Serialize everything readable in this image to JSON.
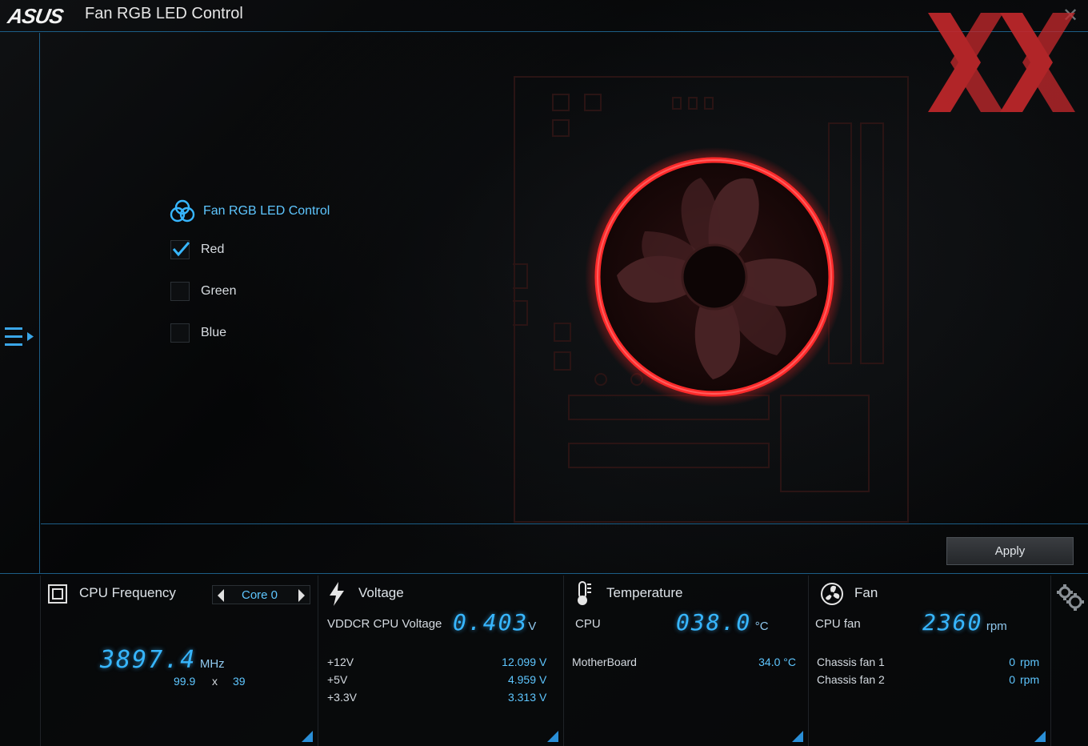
{
  "window": {
    "brand": "ASUS",
    "title": "Fan RGB LED Control",
    "close_glyph": "✕"
  },
  "control": {
    "title": "Fan RGB LED Control",
    "icon": "rgb-circles-icon",
    "options": [
      {
        "label": "Red",
        "checked": true
      },
      {
        "label": "Green",
        "checked": false
      },
      {
        "label": "Blue",
        "checked": false
      }
    ],
    "apply_label": "Apply"
  },
  "cpu_frequency": {
    "title": "CPU Frequency",
    "core_selected": "Core 0",
    "value": "3897.4",
    "unit": "MHz",
    "bclk": "99.9",
    "times": "x",
    "ratio": "39"
  },
  "voltage": {
    "title": "Voltage",
    "main_label": "VDDCR CPU Voltage",
    "main_value": "0.403",
    "main_unit": "V",
    "rows": [
      {
        "label": "+12V",
        "value": "12.099",
        "unit": "V"
      },
      {
        "label": "+5V",
        "value": "4.959",
        "unit": "V"
      },
      {
        "label": "+3.3V",
        "value": "3.313",
        "unit": "V"
      }
    ]
  },
  "temperature": {
    "title": "Temperature",
    "main_label": "CPU",
    "main_value": "038.0",
    "main_unit": "°C",
    "rows": [
      {
        "label": "MotherBoard",
        "value": "34.0 °C"
      }
    ]
  },
  "fan": {
    "title": "Fan",
    "main_label": "CPU fan",
    "main_value": "2360",
    "main_unit": "rpm",
    "rows": [
      {
        "label": "Chassis fan 1",
        "value": "0",
        "unit": "rpm"
      },
      {
        "label": "Chassis fan 2",
        "value": "0",
        "unit": "rpm"
      }
    ]
  },
  "colors": {
    "accent_blue": "#37b6ff",
    "fan_ring_red": "#ff2a2a",
    "watermark_red": "#c0282b"
  }
}
